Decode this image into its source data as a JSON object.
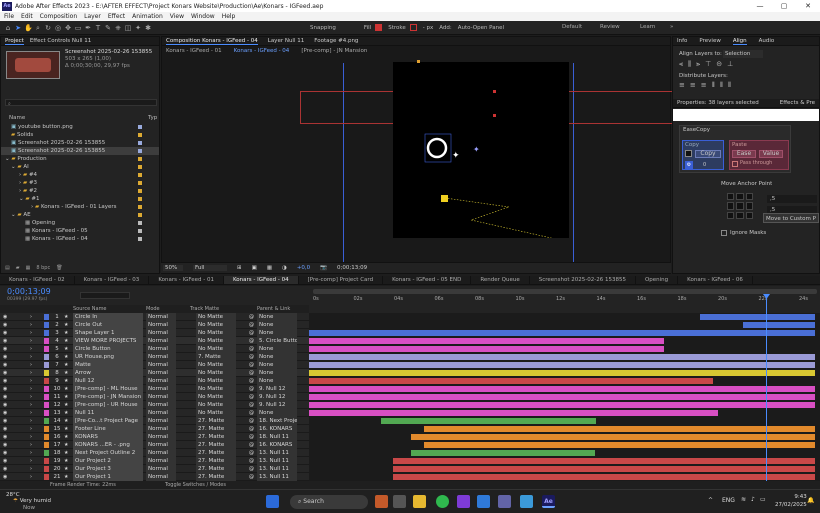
{
  "titlebar": {
    "logo": "Ae",
    "title": "Adobe After Effects 2023 - E:\\AFTER EFFECT\\Project Konars Website\\Production\\Ae\\Konars - IGFeed.aep",
    "controls": [
      "—",
      "▢",
      "✕"
    ]
  },
  "menu": [
    "File",
    "Edit",
    "Composition",
    "Layer",
    "Effect",
    "Animation",
    "View",
    "Window",
    "Help"
  ],
  "toolbar": {
    "snapping": "Snapping",
    "fill": "Fill",
    "stroke": "Stroke",
    "stroke_px": "- px",
    "add": "Add:",
    "auto_open": "Auto-Open Panel",
    "workspaces": [
      "Default",
      "Review",
      "Learn"
    ],
    "ws_menu": "»"
  },
  "project": {
    "tabs": [
      "Project",
      "Effect Controls Null 11"
    ],
    "thumb_name": "Screenshot 2025-02-26 153855",
    "thumb_meta1": "503 x 265 (1,00)",
    "thumb_meta2": "Δ 0;00;30;00, 29,97 fps",
    "col_name": "Name",
    "col_type": "Typ",
    "items": [
      "youtube button.png",
      "Solids",
      "Screenshot 2025-02-26 153855",
      "Screenshot 2025-02-26 153855",
      "Production",
      "AI",
      "#4",
      "#3",
      "#2",
      "#1",
      "Konars - IGFeed - 01 Layers",
      "AE",
      "Opening",
      "Konars - IGFeed - 05",
      "Konars - IGFeed - 04"
    ],
    "bpc": "8 bpc"
  },
  "comp": {
    "tabs": [
      "Composition Konars - IGFeed - 04",
      "Layer Null 11",
      "Footage #4.png"
    ],
    "subtabs": [
      "Konars - IGFeed - 01",
      "Konars - IGFeed - 04",
      "[Pre-comp] - JN Mansion"
    ],
    "zoom": "50%",
    "quality": "Full",
    "exposure": "+0,0",
    "timecode": "0;00;13;09"
  },
  "right": {
    "tabs": [
      "Info",
      "Preview",
      "Align",
      "Audio"
    ],
    "align_to_label": "Align Layers to:",
    "align_to": "Selection",
    "distribute": "Distribute Layers:",
    "props_header": "Properties: 38 layers selected",
    "effects_tab": "Effects & Pre",
    "easecopy_title": "EaseCopy",
    "copy_label": "Copy",
    "copy_btn": "Copy",
    "paste_label": "Paste",
    "ease_btn": "Ease",
    "value_btn": "Value",
    "pass_through": "Pass through",
    "zero": "0",
    "move_anchor": "Move Anchor Point",
    "x_val": ",5",
    "y_val": ",5",
    "move_custom": "Move to Custom P",
    "ignore_masks": "Ignore Masks"
  },
  "timeline": {
    "tabs": [
      "Konars - IGFeed - 02",
      "Konars - IGFeed - 03",
      "Konars - IGFeed - 01",
      "Konars - IGFeed - 04",
      "[Pre-comp] Project Card",
      "Konars - IGFeed - 05 END",
      "Render Queue",
      "Screenshot 2025-02-26 153855",
      "Opening",
      "Konars - IGFeed - 06"
    ],
    "current_time": "0;00;13;09",
    "frames": "00399 (29.97 fps)",
    "headers": {
      "source": "Source Name",
      "mode": "Mode",
      "track": "Track Matte",
      "parent": "Parent & Link"
    },
    "ruler": [
      "0s",
      "02s",
      "04s",
      "06s",
      "08s",
      "10s",
      "12s",
      "14s",
      "16s",
      "18s",
      "20s",
      "22s",
      "24s"
    ],
    "render_time": "Frame Render Time: 22ms",
    "toggle": "Toggle Switches / Modes",
    "layers": [
      {
        "n": "1",
        "name": "Circle In",
        "mode": "Normal",
        "tm": "No Matte",
        "parent": "None",
        "color": "#4a6fd6",
        "bs": 0.765,
        "be": 0.99
      },
      {
        "n": "2",
        "name": "Circle Out",
        "mode": "Normal",
        "tm": "No Matte",
        "parent": "None",
        "color": "#4a6fd6",
        "bs": 0.85,
        "be": 0.99
      },
      {
        "n": "3",
        "name": "Shape Layer 1",
        "mode": "Normal",
        "tm": "No Matte",
        "parent": "None",
        "color": "#4a6fd6",
        "bs": 0,
        "be": 0.99
      },
      {
        "n": "4",
        "name": "VIEW MORE PROJECTS",
        "mode": "Normal",
        "tm": "No Matte",
        "parent": "5. Circle Butto",
        "color": "#d84fc3",
        "bs": 0,
        "be": 0.695
      },
      {
        "n": "5",
        "name": "Circle Button",
        "mode": "Normal",
        "tm": "No Matte",
        "parent": "None",
        "color": "#d84fc3",
        "bs": 0,
        "be": 0.695
      },
      {
        "n": "6",
        "name": "UR House.png",
        "mode": "Normal",
        "tm": "7. Matte",
        "parent": "None",
        "color": "#9a9ad6",
        "bs": 0,
        "be": 0.99
      },
      {
        "n": "7",
        "name": "Matte",
        "mode": "Normal",
        "tm": "No Matte",
        "parent": "None",
        "color": "#9a9ad6",
        "bs": 0,
        "be": 0.99
      },
      {
        "n": "8",
        "name": "Arrow",
        "mode": "Normal",
        "tm": "No Matte",
        "parent": "None",
        "color": "#d8c832",
        "bs": 0,
        "be": 0.99
      },
      {
        "n": "9",
        "name": "Null 12",
        "mode": "Normal",
        "tm": "No Matte",
        "parent": "None",
        "color": "#c84848",
        "bs": 0,
        "be": 0.79
      },
      {
        "n": "10",
        "name": "[Pre-comp] - ML House",
        "mode": "Normal",
        "tm": "No Matte",
        "parent": "9. Null 12",
        "color": "#d84fc3",
        "bs": 0,
        "be": 0.99
      },
      {
        "n": "11",
        "name": "[Pre-comp] - JN Mansion",
        "mode": "Normal",
        "tm": "No Matte",
        "parent": "9. Null 12",
        "color": "#d84fc3",
        "bs": 0,
        "be": 0.99
      },
      {
        "n": "12",
        "name": "[Pre-comp] - UR House",
        "mode": "Normal",
        "tm": "No Matte",
        "parent": "9. Null 12",
        "color": "#d84fc3",
        "bs": 0,
        "be": 0.99
      },
      {
        "n": "13",
        "name": "Null 11",
        "mode": "Normal",
        "tm": "No Matte",
        "parent": "None",
        "color": "#d84fc3",
        "bs": 0,
        "be": 0.8
      },
      {
        "n": "14",
        "name": "[Pre-Co...t Project Page",
        "mode": "Normal",
        "tm": "27. Matte",
        "parent": "18. Next Proje",
        "color": "#52a852",
        "bs": 0.14,
        "be": 0.56
      },
      {
        "n": "15",
        "name": "Footer Line",
        "mode": "Normal",
        "tm": "27. Matte",
        "parent": "16. KONARS",
        "color": "#e28a2c",
        "bs": 0.225,
        "be": 0.99
      },
      {
        "n": "16",
        "name": "KONARS",
        "mode": "Normal",
        "tm": "27. Matte",
        "parent": "18. Null 11",
        "color": "#e28a2c",
        "bs": 0.2,
        "be": 0.99
      },
      {
        "n": "17",
        "name": "KONARS ...ER - .png",
        "mode": "Normal",
        "tm": "27. Matte",
        "parent": "16. KONARS",
        "color": "#e28a2c",
        "bs": 0.225,
        "be": 0.99
      },
      {
        "n": "18",
        "name": "Next Project Outline 2",
        "mode": "Normal",
        "tm": "27. Matte",
        "parent": "13. Null 11",
        "color": "#52a852",
        "bs": 0.2,
        "be": 0.56
      },
      {
        "n": "19",
        "name": "Our Project 2",
        "mode": "Normal",
        "tm": "27. Matte",
        "parent": "13. Null 11",
        "color": "#c84848",
        "bs": 0.165,
        "be": 0.99
      },
      {
        "n": "20",
        "name": "Our Project 3",
        "mode": "Normal",
        "tm": "27. Matte",
        "parent": "13. Null 11",
        "color": "#c84848",
        "bs": 0.165,
        "be": 0.99
      },
      {
        "n": "21",
        "name": "Our Project 1",
        "mode": "Normal",
        "tm": "27. Matte",
        "parent": "13. Null 11",
        "color": "#c84848",
        "bs": 0.165,
        "be": 0.99
      }
    ]
  },
  "taskbar": {
    "weather_temp": "28°C",
    "weather_line1": "Very humid",
    "weather_line2": "Now",
    "search": "Search",
    "tray_arrow": "^",
    "lang": "ENG",
    "time": "9:43",
    "date": "27/02/2025",
    "ae_icon": "Ae"
  }
}
